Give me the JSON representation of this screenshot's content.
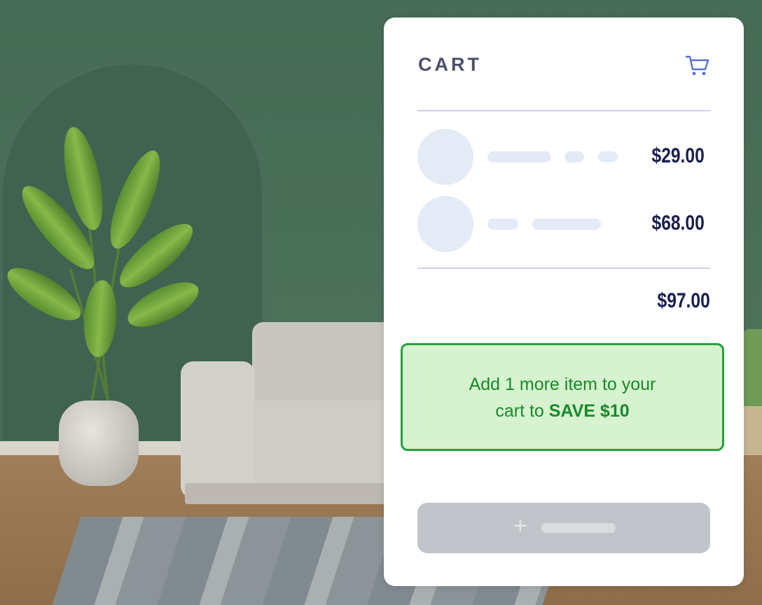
{
  "cart": {
    "title": "CART",
    "icon": "cart-icon",
    "items": [
      {
        "price": "$29.00"
      },
      {
        "price": "$68.00"
      }
    ],
    "total": "$97.00",
    "promo": {
      "line1": "Add 1 more item to your",
      "line2_prefix": "cart to ",
      "line2_bold": "SAVE $10"
    },
    "add_button": {
      "icon": "plus-icon"
    }
  },
  "colors": {
    "title": "#4e4f6a",
    "price": "#1a1d4e",
    "placeholder": "#e4eaf6",
    "divider": "#cfd0f2",
    "promo_border": "#23a33d",
    "promo_bg": "#d6f2ce",
    "promo_text": "#178a2c",
    "button": "#c1c4c9"
  }
}
